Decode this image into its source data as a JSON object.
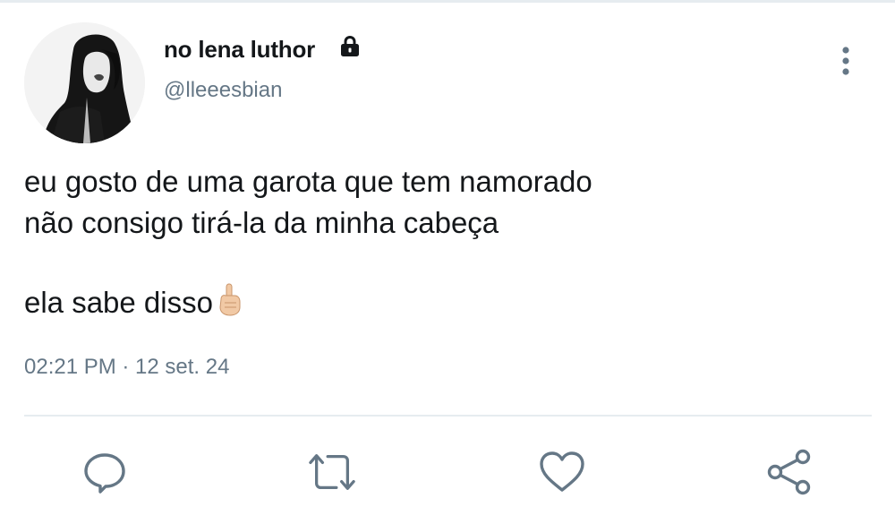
{
  "tweet": {
    "author": {
      "display_name": "no lena luthor",
      "handle": "@lleeesbian",
      "avatar_icon": "avatar-photo",
      "protected_icon": "lock-icon"
    },
    "text_lines": [
      "eu gosto de uma garota que tem namorado",
      "não consigo tirá-la da minha cabeça",
      "ela sabe disso"
    ],
    "emoji_icon": "pointing-up-finger-icon",
    "timestamp": "02:21 PM · 12 set. 24"
  },
  "actions": [
    {
      "name": "reply",
      "icon": "comment-icon"
    },
    {
      "name": "retweet",
      "icon": "retweet-icon"
    },
    {
      "name": "like",
      "icon": "heart-icon"
    },
    {
      "name": "share",
      "icon": "share-icon"
    }
  ],
  "colors": {
    "text": "#14171a",
    "secondary": "#657786",
    "icon": "#657786",
    "divider": "#e6ecf0"
  }
}
